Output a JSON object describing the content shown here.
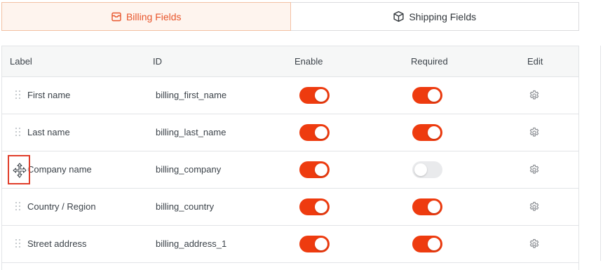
{
  "tabs": [
    {
      "label": "Billing Fields",
      "icon": "billing-box-icon",
      "active": true
    },
    {
      "label": "Shipping Fields",
      "icon": "package-icon",
      "active": false
    }
  ],
  "table": {
    "headers": {
      "label": "Label",
      "id": "ID",
      "enable": "Enable",
      "required": "Required",
      "edit": "Edit"
    },
    "rows": [
      {
        "label": "First name",
        "id": "billing_first_name",
        "enable": true,
        "required": true
      },
      {
        "label": "Last name",
        "id": "billing_last_name",
        "enable": true,
        "required": true
      },
      {
        "label": "Company name",
        "id": "billing_company",
        "enable": true,
        "required": false
      },
      {
        "label": "Country / Region",
        "id": "billing_country",
        "enable": true,
        "required": true
      },
      {
        "label": "Street address",
        "id": "billing_address_1",
        "enable": true,
        "required": true
      }
    ]
  },
  "colors": {
    "accent": "#ee3b0f",
    "toggle_off": "#e9eaec",
    "active_tab_bg": "#fef4ee",
    "drag_highlight": "#e03e2b"
  },
  "icons": {
    "drag_handle": "drag-handle-icon",
    "edit": "gear-icon",
    "move_cursor": "move-cursor-icon"
  }
}
